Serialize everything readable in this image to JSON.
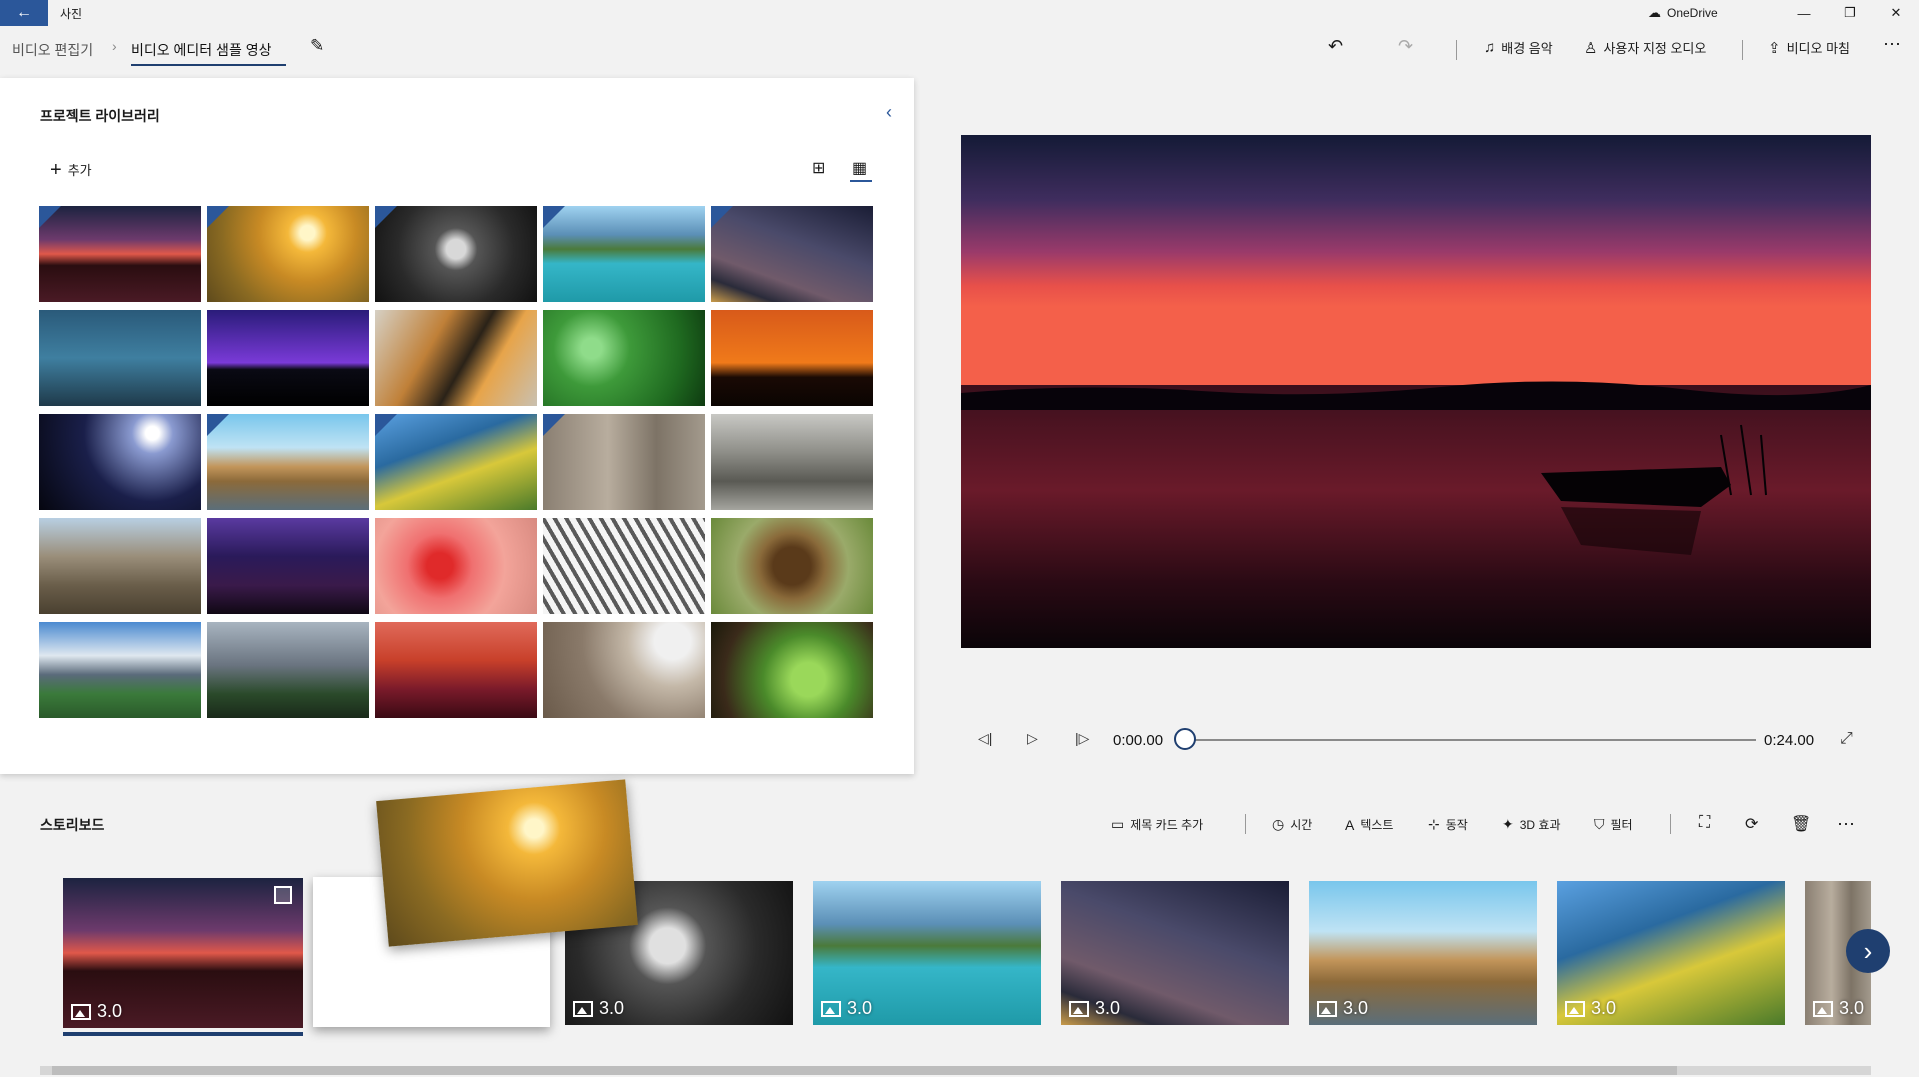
{
  "titlebar": {
    "app_name": "사진",
    "onedrive_label": "OneDrive"
  },
  "breadcrumb": {
    "parent": "비디오 편집기",
    "current": "비디오 에디터 샘플 영상"
  },
  "commands": {
    "background_music": "배경 음악",
    "custom_audio": "사용자 지정 오디오",
    "finish_video": "비디오 마침"
  },
  "library": {
    "title": "프로젝트 라이브러리",
    "add_label": "추가"
  },
  "player": {
    "current_time": "0:00.00",
    "total_time": "0:24.00",
    "progress": 0
  },
  "storyboard": {
    "title": "스토리보드",
    "tools": {
      "title_card": "제목 카드 추가",
      "duration": "시간",
      "text": "텍스트",
      "motion": "동작",
      "effects_3d": "3D 효과",
      "filters": "필터"
    },
    "cards": [
      {
        "duration": "3.0"
      },
      {
        "duration": "3.0"
      },
      {
        "duration": "3.0"
      },
      {
        "duration": "3.0"
      },
      {
        "duration": "3.0"
      },
      {
        "duration": "3.0"
      },
      {
        "duration": "3.0"
      }
    ]
  },
  "colors": {
    "accent": "#2b579a",
    "selection": "#1f3f70"
  },
  "icons": [
    "back-arrow-icon",
    "onedrive-icon",
    "pencil-icon",
    "undo-icon",
    "redo-icon",
    "music-note-icon",
    "person-audio-icon",
    "share-icon",
    "more-icon",
    "chevron-left-icon",
    "plus-icon",
    "large-grid-icon",
    "small-grid-icon",
    "previous-frame-icon",
    "play-icon",
    "next-frame-icon",
    "fullscreen-icon",
    "title-card-icon",
    "clock-icon",
    "text-icon",
    "motion-icon",
    "effects-3d-icon",
    "filter-icon",
    "resize-icon",
    "rotate-icon",
    "trash-icon",
    "chevron-right-icon",
    "image-icon"
  ]
}
